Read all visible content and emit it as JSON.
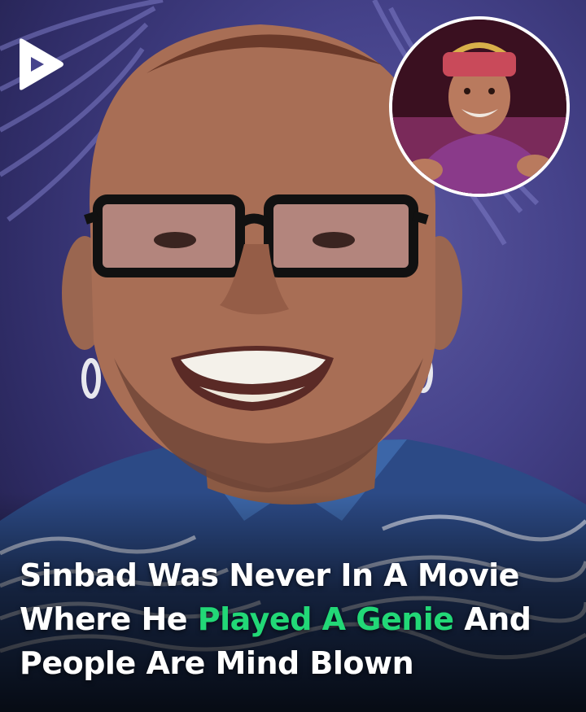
{
  "headline": {
    "line1": "Sinbad Was Never In A Movie",
    "line2_start": "Where He ",
    "line2_highlight": "Played A Genie",
    "line2_end": " And",
    "line3": "People Are Mind Blown"
  },
  "colors": {
    "highlight": "#22d877",
    "text": "#ffffff",
    "background": "#45428a",
    "inset_border": "#ffffff"
  },
  "icons": {
    "logo": "play-logo-icon"
  }
}
